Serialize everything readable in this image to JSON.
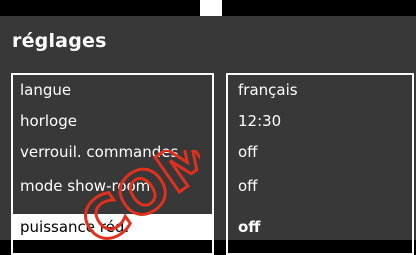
{
  "settings": {
    "title": "réglages",
    "items": [
      {
        "label": "langue",
        "value": "français"
      },
      {
        "label": "horloge",
        "value": "12:30"
      },
      {
        "label": "verrouil. commandes",
        "value": "off"
      },
      {
        "label": "mode show-room",
        "value": "off"
      },
      {
        "label": "puissance réd.",
        "value": "off"
      }
    ],
    "selected_index": 4
  },
  "watermark": {
    "text": "COM",
    "color": "#e0301e"
  }
}
